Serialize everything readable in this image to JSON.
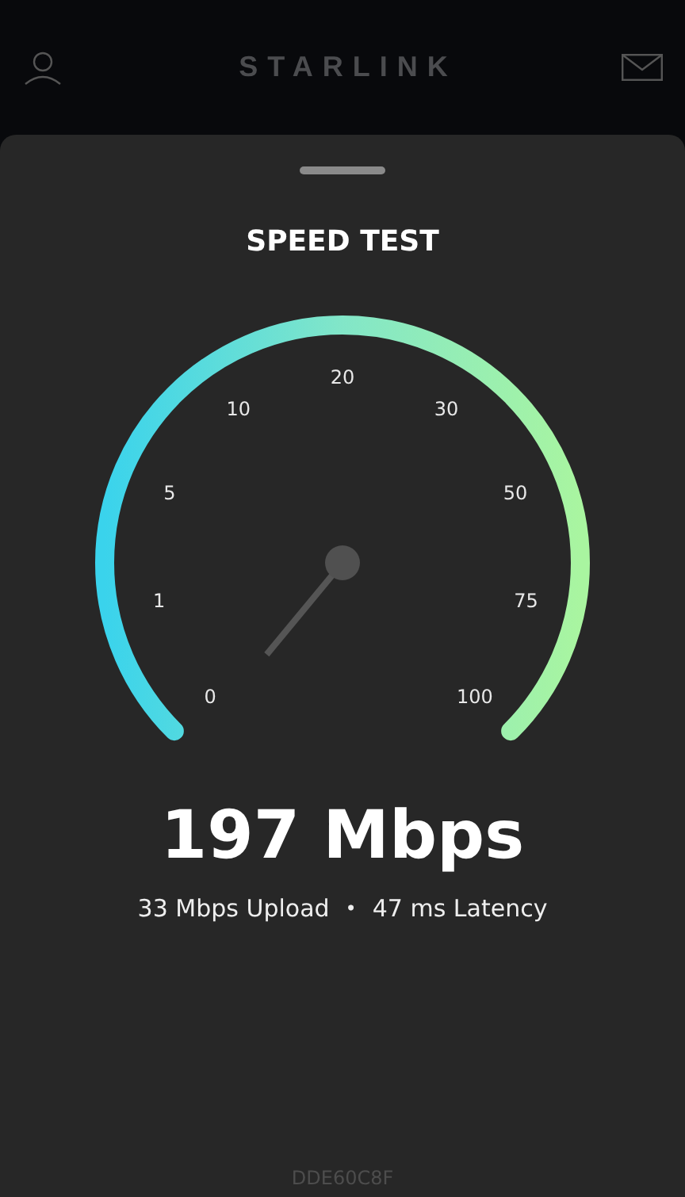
{
  "header": {
    "brand": "STARLINK"
  },
  "sheet": {
    "title": "SPEED TEST",
    "gauge": {
      "ticks": [
        "0",
        "1",
        "5",
        "10",
        "20",
        "30",
        "50",
        "75",
        "100"
      ]
    },
    "download": "197 Mbps",
    "upload": "33 Mbps Upload",
    "separator": "•",
    "latency": "47 ms Latency",
    "device_id": "DDE60C8F"
  }
}
